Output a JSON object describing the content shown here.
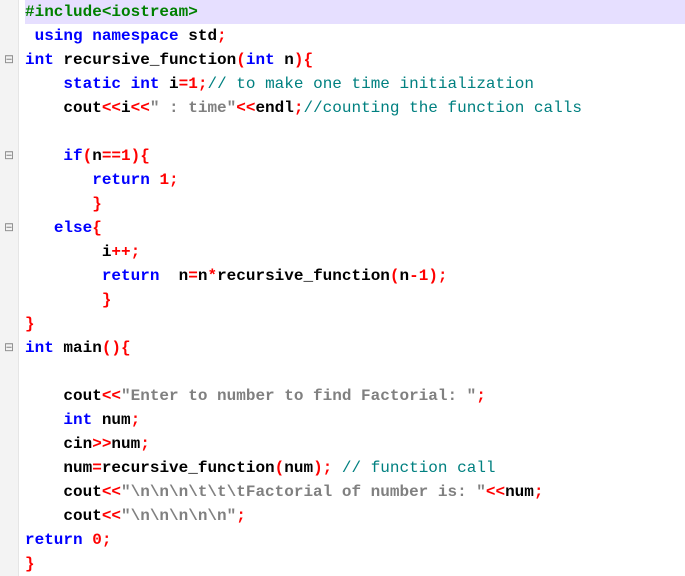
{
  "gutter": [
    "",
    "",
    "⊟",
    "",
    "",
    "",
    "⊟",
    "",
    "",
    "⊟",
    "",
    "",
    "",
    "",
    "⊟",
    "",
    "",
    "",
    "",
    "",
    "",
    "",
    "",
    ""
  ],
  "lines": [
    [
      {
        "c": "preproc",
        "t": "#include<iostream>"
      }
    ],
    [
      {
        "c": "kw",
        "t": " using"
      },
      {
        "c": "plain",
        "t": " "
      },
      {
        "c": "kw",
        "t": "namespace"
      },
      {
        "c": "plain",
        "t": " std"
      },
      {
        "c": "op",
        "t": ";"
      }
    ],
    [
      {
        "c": "kw",
        "t": "int"
      },
      {
        "c": "plain",
        "t": " recursive_function"
      },
      {
        "c": "op",
        "t": "("
      },
      {
        "c": "kw",
        "t": "int"
      },
      {
        "c": "plain",
        "t": " n"
      },
      {
        "c": "op",
        "t": "){"
      }
    ],
    [
      {
        "c": "plain",
        "t": "    "
      },
      {
        "c": "kw",
        "t": "static"
      },
      {
        "c": "plain",
        "t": " "
      },
      {
        "c": "kw",
        "t": "int"
      },
      {
        "c": "plain",
        "t": " i"
      },
      {
        "c": "op",
        "t": "="
      },
      {
        "c": "num",
        "t": "1"
      },
      {
        "c": "op",
        "t": ";"
      },
      {
        "c": "cmt",
        "t": "// to make one time initialization"
      }
    ],
    [
      {
        "c": "plain",
        "t": "    cout"
      },
      {
        "c": "op",
        "t": "<<"
      },
      {
        "c": "plain",
        "t": "i"
      },
      {
        "c": "op",
        "t": "<<"
      },
      {
        "c": "str",
        "t": "\" : time\""
      },
      {
        "c": "op",
        "t": "<<"
      },
      {
        "c": "plain",
        "t": "endl"
      },
      {
        "c": "op",
        "t": ";"
      },
      {
        "c": "cmt",
        "t": "//counting the function calls"
      }
    ],
    [
      {
        "c": "plain",
        "t": " "
      }
    ],
    [
      {
        "c": "plain",
        "t": "    "
      },
      {
        "c": "kw",
        "t": "if"
      },
      {
        "c": "op",
        "t": "("
      },
      {
        "c": "plain",
        "t": "n"
      },
      {
        "c": "op",
        "t": "=="
      },
      {
        "c": "num",
        "t": "1"
      },
      {
        "c": "op",
        "t": "){"
      }
    ],
    [
      {
        "c": "plain",
        "t": "       "
      },
      {
        "c": "kw",
        "t": "return"
      },
      {
        "c": "plain",
        "t": " "
      },
      {
        "c": "num",
        "t": "1"
      },
      {
        "c": "op",
        "t": ";"
      }
    ],
    [
      {
        "c": "plain",
        "t": "       "
      },
      {
        "c": "op",
        "t": "}"
      }
    ],
    [
      {
        "c": "plain",
        "t": "   "
      },
      {
        "c": "kw",
        "t": "else"
      },
      {
        "c": "op",
        "t": "{"
      }
    ],
    [
      {
        "c": "plain",
        "t": "        i"
      },
      {
        "c": "op",
        "t": "++;"
      }
    ],
    [
      {
        "c": "plain",
        "t": "        "
      },
      {
        "c": "kw",
        "t": "return"
      },
      {
        "c": "plain",
        "t": "  n"
      },
      {
        "c": "op",
        "t": "="
      },
      {
        "c": "plain",
        "t": "n"
      },
      {
        "c": "op",
        "t": "*"
      },
      {
        "c": "plain",
        "t": "recursive_function"
      },
      {
        "c": "op",
        "t": "("
      },
      {
        "c": "plain",
        "t": "n"
      },
      {
        "c": "op",
        "t": "-"
      },
      {
        "c": "num",
        "t": "1"
      },
      {
        "c": "op",
        "t": ");"
      }
    ],
    [
      {
        "c": "plain",
        "t": "        "
      },
      {
        "c": "op",
        "t": "}"
      }
    ],
    [
      {
        "c": "op",
        "t": "}"
      }
    ],
    [
      {
        "c": "kw",
        "t": "int"
      },
      {
        "c": "plain",
        "t": " main"
      },
      {
        "c": "op",
        "t": "(){"
      }
    ],
    [
      {
        "c": "plain",
        "t": " "
      }
    ],
    [
      {
        "c": "plain",
        "t": "    cout"
      },
      {
        "c": "op",
        "t": "<<"
      },
      {
        "c": "str",
        "t": "\"Enter to number to find Factorial: \""
      },
      {
        "c": "op",
        "t": ";"
      }
    ],
    [
      {
        "c": "plain",
        "t": "    "
      },
      {
        "c": "kw",
        "t": "int"
      },
      {
        "c": "plain",
        "t": " num"
      },
      {
        "c": "op",
        "t": ";"
      }
    ],
    [
      {
        "c": "plain",
        "t": "    cin"
      },
      {
        "c": "op",
        "t": ">>"
      },
      {
        "c": "plain",
        "t": "num"
      },
      {
        "c": "op",
        "t": ";"
      }
    ],
    [
      {
        "c": "plain",
        "t": "    num"
      },
      {
        "c": "op",
        "t": "="
      },
      {
        "c": "plain",
        "t": "recursive_function"
      },
      {
        "c": "op",
        "t": "("
      },
      {
        "c": "plain",
        "t": "num"
      },
      {
        "c": "op",
        "t": ");"
      },
      {
        "c": "plain",
        "t": " "
      },
      {
        "c": "cmt",
        "t": "// function call"
      }
    ],
    [
      {
        "c": "plain",
        "t": "    cout"
      },
      {
        "c": "op",
        "t": "<<"
      },
      {
        "c": "str",
        "t": "\"\\n\\n\\n\\t\\t\\tFactorial of number is: \""
      },
      {
        "c": "op",
        "t": "<<"
      },
      {
        "c": "plain",
        "t": "num"
      },
      {
        "c": "op",
        "t": ";"
      }
    ],
    [
      {
        "c": "plain",
        "t": "    cout"
      },
      {
        "c": "op",
        "t": "<<"
      },
      {
        "c": "str",
        "t": "\"\\n\\n\\n\\n\\n\""
      },
      {
        "c": "op",
        "t": ";"
      }
    ],
    [
      {
        "c": "kw",
        "t": "return"
      },
      {
        "c": "plain",
        "t": " "
      },
      {
        "c": "num",
        "t": "0"
      },
      {
        "c": "op",
        "t": ";"
      }
    ],
    [
      {
        "c": "op",
        "t": "}"
      }
    ]
  ],
  "highlight_first": true
}
